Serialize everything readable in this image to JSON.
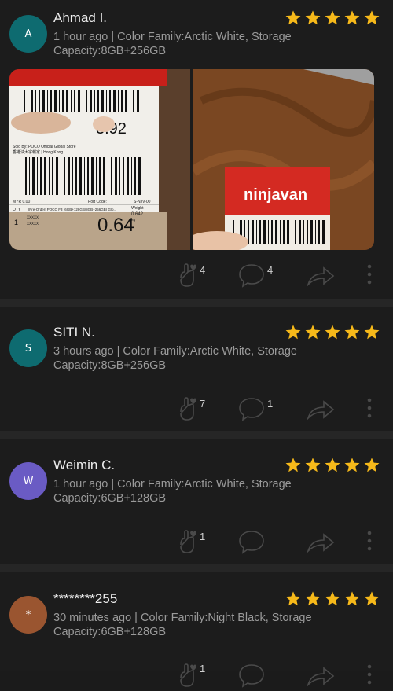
{
  "reviews": [
    {
      "name": "Ahmad I.",
      "avatar_letter": "A",
      "avatar_color": "#0e6b70",
      "meta": "1  hour ago | Color Family:Arctic White, Storage Capacity:8GB+256GB",
      "rating": 5,
      "likes": "4",
      "comments": "4",
      "photos": {
        "photo1": {
          "handwritten_top": "3.92",
          "store_line": "Sold By: POCO Official Global Store",
          "hk_line": "香港油大字報家 | Hong Kong",
          "order_line": "[Pre-Order] POCO F3 (6GB+128GB/8GB+256GB) Glo...",
          "myr": "MYR 0.00",
          "port_code": "Port Code:",
          "code": "S-NJV-00",
          "qty_label": "QTY",
          "qty": "1",
          "xxx1": "XXXXX",
          "xxx2": "XXXXX",
          "weight_label": "Weight",
          "weight_val": "0.642",
          "weight_unit": "kg",
          "handwritten_bottom": "0.64"
        },
        "photo2": {
          "brand": "ninjavan"
        }
      }
    },
    {
      "name": "SITI N.",
      "avatar_letter": "S",
      "avatar_color": "#0e6b70",
      "meta": "3  hours ago | Color Family:Arctic White, Storage Capacity:8GB+256GB",
      "rating": 5,
      "likes": "7",
      "comments": "1"
    },
    {
      "name": "Weimin C.",
      "avatar_letter": "W",
      "avatar_color": "#6a5bc4",
      "meta": "1  hour ago | Color Family:Arctic White, Storage Capacity:6GB+128GB",
      "rating": 5,
      "likes": "1",
      "comments": ""
    },
    {
      "name": "********255",
      "avatar_letter": "*",
      "avatar_color": "#9a5530",
      "meta": "30  minutes ago | Color Family:Night Black, Storage Capacity:6GB+128GB",
      "rating": 5,
      "likes": "1",
      "comments": ""
    }
  ],
  "icons": {
    "like": "finger-heart-icon",
    "comment": "comment-bubble-icon",
    "share": "share-arrow-icon",
    "more": "more-vertical-icon",
    "star": "star-icon"
  },
  "colors": {
    "star": "#f6b91a",
    "background": "#1b1b1b",
    "separator": "#262626"
  }
}
